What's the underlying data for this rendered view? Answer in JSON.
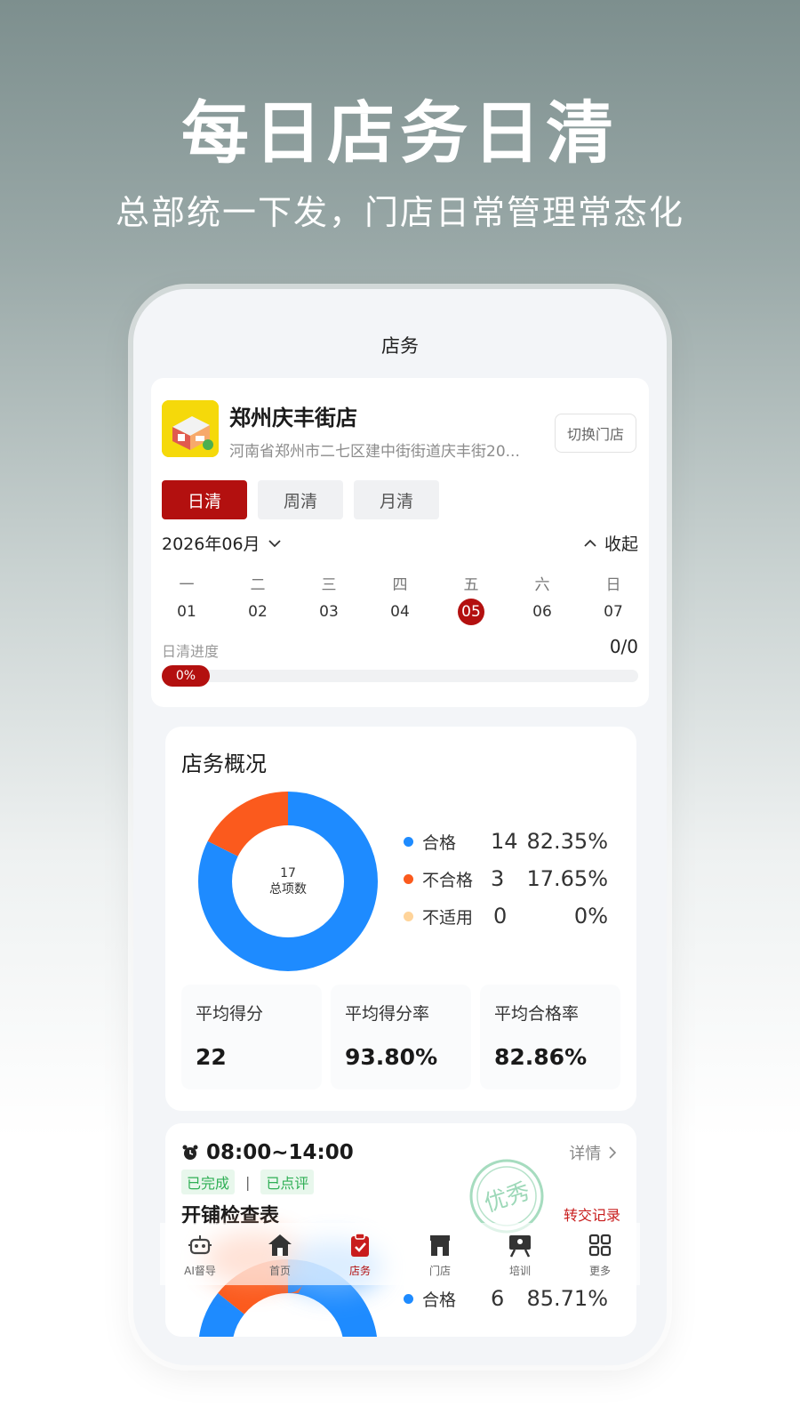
{
  "hero": {
    "title": "每日店务日清",
    "subtitle": "总部统一下发，门店日常管理常态化"
  },
  "nav": {
    "title": "店务"
  },
  "store": {
    "name": "郑州庆丰街店",
    "address": "河南省郑州市二七区建中街街道庆丰街20...",
    "switch_label": "切换门店"
  },
  "tabs": [
    {
      "label": "日清",
      "active": true
    },
    {
      "label": "周清",
      "active": false
    },
    {
      "label": "月清",
      "active": false
    }
  ],
  "calendar": {
    "month": "2026年06月",
    "collapse_label": "收起",
    "weekdays": [
      "一",
      "二",
      "三",
      "四",
      "五",
      "六",
      "日"
    ],
    "dates": [
      "01",
      "02",
      "03",
      "04",
      "05",
      "06",
      "07"
    ],
    "selected": "05"
  },
  "progress": {
    "label": "日清进度",
    "count": "0/0",
    "percent_text": "0%",
    "percent": 0
  },
  "overview": {
    "title": "店务概况",
    "total": "17",
    "total_label": "总项数",
    "legend": [
      {
        "name": "合格",
        "count": "14",
        "pct": "82.35%",
        "color": "#1e8bff"
      },
      {
        "name": "不合格",
        "count": "3",
        "pct": "17.65%",
        "color": "#fb5a1d"
      },
      {
        "name": "不适用",
        "count": "0",
        "pct": "0%",
        "color": "#ffd49a"
      }
    ],
    "stats": [
      {
        "label": "平均得分",
        "value": "22"
      },
      {
        "label": "平均得分率",
        "value": "93.80%"
      },
      {
        "label": "平均合格率",
        "value": "82.86%"
      }
    ]
  },
  "task": {
    "time": "08:00~14:00",
    "detail_label": "详情",
    "tag_done": "已完成",
    "tag_sep": "|",
    "tag_reviewed": "已点评",
    "name": "开铺检查表",
    "stamp_text": "优秀",
    "transfer_label": "转交记录",
    "legend": [
      {
        "name": "合格",
        "count": "6",
        "pct": "85.71%",
        "color": "#1e8bff"
      }
    ],
    "pass_ratio": 0.8571
  },
  "tabbar": [
    {
      "label": "AI督导",
      "icon": "robot-icon",
      "active": false
    },
    {
      "label": "首页",
      "icon": "home-icon",
      "active": false
    },
    {
      "label": "店务",
      "icon": "clipboard-check-icon",
      "active": true
    },
    {
      "label": "门店",
      "icon": "store-icon",
      "active": false
    },
    {
      "label": "培训",
      "icon": "training-board-icon",
      "active": false
    },
    {
      "label": "更多",
      "icon": "grid-more-icon",
      "active": false
    }
  ],
  "colors": {
    "brand_red": "#b3100f",
    "pass_blue": "#1e8bff",
    "fail_orange": "#fb5a1d",
    "na_beige": "#ffd49a",
    "tag_green": "#2faf55"
  }
}
